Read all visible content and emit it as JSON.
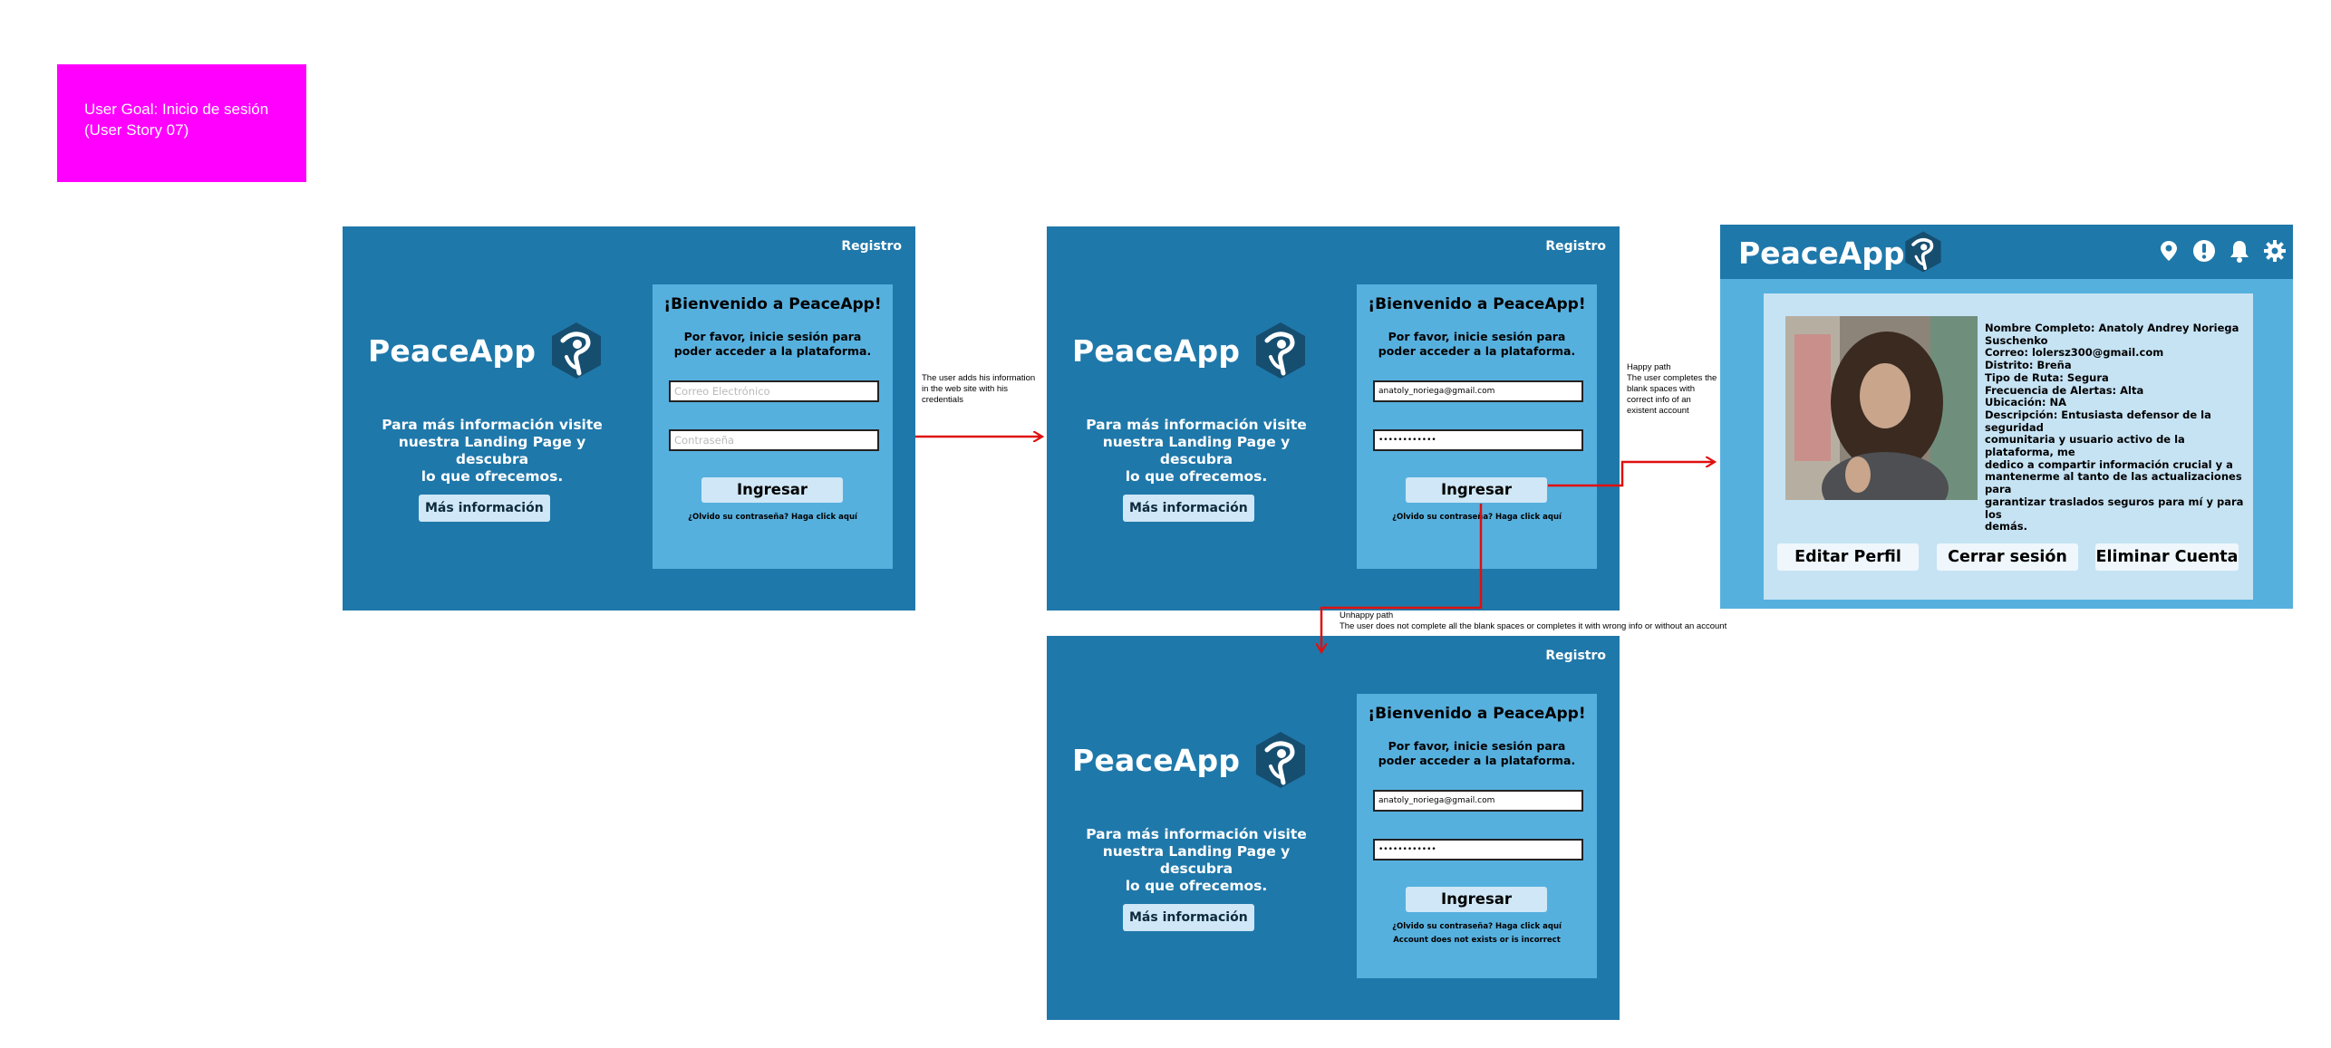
{
  "goal": {
    "line1": "User Goal: Inicio de sesión",
    "line2": "(User Story 07)"
  },
  "login": {
    "registro": "Registro",
    "brand": "PeaceApp",
    "info_line1": "Para más información visite",
    "info_line2": "nuestra Landing Page y descubra",
    "info_line3": "lo que ofrecemos.",
    "more_info": "Más información",
    "welcome": "¡Bienvenido a PeaceApp!",
    "sub_line1": "Por favor, inicie sesión para",
    "sub_line2": "poder acceder a la plataforma.",
    "email_placeholder": "Correo Electrónico",
    "password_placeholder": "Contraseña",
    "email_value": "anatoly_noriega@gmail.com",
    "password_value": "••••••••••••",
    "submit": "Ingresar",
    "forgot": "¿Olvido su contraseña? Haga click aquí",
    "error": "Account does not exists or is incorrect"
  },
  "notes": {
    "step1_line1": "The user adds his information",
    "step1_line2": "in the web site with his",
    "step1_line3": "credentials",
    "happy_title": "Happy path",
    "happy_line1": "The user completes the",
    "happy_line2": "blank spaces with",
    "happy_line3": "correct info of an",
    "happy_line4": "existent account",
    "unhappy_title": "Unhappy path",
    "unhappy_line1": "The user does not complete all the blank spaces or completes it with wrong info or without an account"
  },
  "profile": {
    "brand": "PeaceApp",
    "icons": [
      "location-pin-icon",
      "alert-icon",
      "bell-icon",
      "gear-icon"
    ],
    "nombre": "Nombre Completo: Anatoly Andrey Noriega",
    "nombre2": "Suschenko",
    "correo": "Correo: lolersz300@gmail.com",
    "distrito": "Distrito: Breña",
    "ruta": "Tipo de Ruta: Segura",
    "frecuencia": "Frecuencia de Alertas: Alta",
    "ubicacion": "Ubicación: NA",
    "desc1": "Descripción: Entusiasta defensor de la seguridad",
    "desc2": "comunitaria y usuario activo de la plataforma, me",
    "desc3": "dedico a compartir información crucial y a",
    "desc4": "mantenerme al tanto de las actualizaciones para",
    "desc5": "garantizar traslados seguros para mí y para los",
    "desc6": "demás.",
    "edit": "Editar Perfil",
    "logout": "Cerrar sesión",
    "delete": "Eliminar Cuenta"
  },
  "colors": {
    "frame": "#1f78aa",
    "panel": "#56b0de",
    "goal": "#ff00ff",
    "arrow": "#e01010"
  }
}
